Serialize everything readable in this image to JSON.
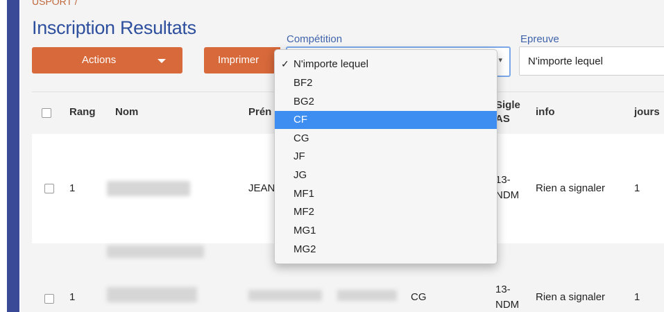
{
  "breadcrumb": "USPORT /",
  "page_title": "Inscription Resultats",
  "toolbar": {
    "actions_label": "Actions",
    "print_label": "Imprimer"
  },
  "filters": {
    "competition": {
      "label": "Compétition"
    },
    "epreuve": {
      "label": "Epreuve",
      "value": "N'importe lequel"
    }
  },
  "table": {
    "headers": {
      "rang": "Rang",
      "nom": "Nom",
      "prenom": "Prén",
      "sigle_1": "Sigle",
      "sigle_2": "AS",
      "info": "info",
      "jours": "jours"
    },
    "rows": [
      {
        "rang": "1",
        "prenom": "JEAN",
        "sigle_1": "13-",
        "sigle_2": "NDM",
        "info": "Rien a signaler",
        "jours": "1"
      },
      {
        "rang": "1",
        "competition": "CG",
        "sigle_1": "13-",
        "sigle_2": "NDM",
        "info": "Rien a signaler",
        "jours": "1"
      }
    ]
  },
  "dropdown": {
    "check_glyph": "✓",
    "options": [
      "N'importe lequel",
      "BF2",
      "BG2",
      "CF",
      "CG",
      "JF",
      "JG",
      "MF1",
      "MF2",
      "MG1",
      "MG2"
    ],
    "checked": "N'importe lequel",
    "highlighted": "CF"
  },
  "colors": {
    "accent_orange": "#d8693a",
    "title_blue": "#2d4f9d",
    "sidebar_blue": "#3b4a97",
    "highlight": "#3d8ef0"
  }
}
